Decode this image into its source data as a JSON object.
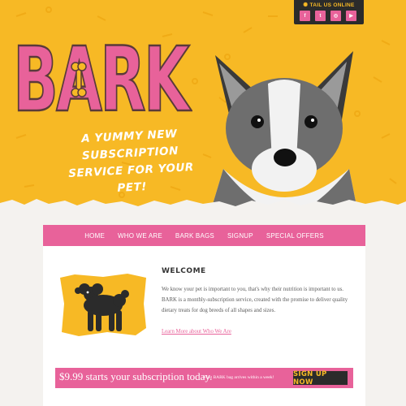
{
  "social": {
    "title": "TAIL US ONLINE",
    "icons": [
      {
        "name": "facebook-icon",
        "glyph": "f"
      },
      {
        "name": "twitter-icon",
        "glyph": "t"
      },
      {
        "name": "instagram-icon",
        "glyph": "◎"
      },
      {
        "name": "youtube-icon",
        "glyph": "▶"
      }
    ]
  },
  "hero": {
    "logo_text": "BARK",
    "tagline": "A YUMMY NEW SUBSCRIPTION SERVICE FOR YOUR PET!"
  },
  "nav": {
    "items": [
      "HOME",
      "WHO WE ARE",
      "BARK BAGS",
      "SIGNUP",
      "SPECIAL OFFERS"
    ],
    "active": "HOME"
  },
  "welcome": {
    "title": "WELCOME",
    "body": "We know your pet is important to you, that's why their nutrition is important to us. BARK is a monthly-subscription service, created with the promise to deliver quality dietary treats for dog breeds of all shapes and sizes.",
    "link": "Learn More about Who We Are"
  },
  "promo": {
    "price_text": "$9.99 starts your subscription today.",
    "note": "First BARK bag arrives within a week!",
    "button": "SIGN UP NOW"
  },
  "colors": {
    "yellow": "#f7b925",
    "pink": "#e8629a",
    "dark": "#2b2b2b"
  }
}
